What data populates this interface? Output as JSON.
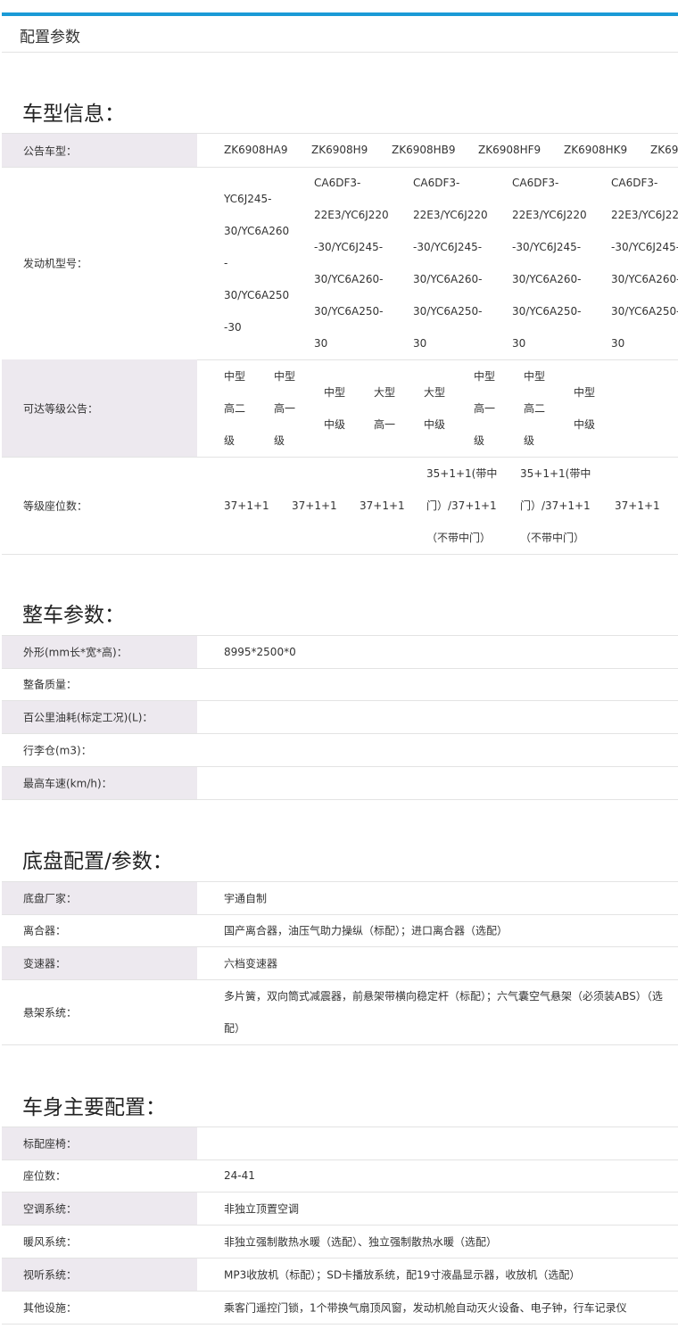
{
  "page_title": "配置参数",
  "sections": {
    "vehicle_info": {
      "title": "车型信息：",
      "models": {
        "label": "公告车型：",
        "values": [
          "ZK6908HA9",
          "ZK6908H9",
          "ZK6908HB9",
          "ZK6908HF9",
          "ZK6908HK9",
          "ZK69"
        ]
      },
      "engines": {
        "label": "发动机型号：",
        "col1": [
          "YC6J245-",
          "30/YC6A260",
          "-",
          "30/YC6A250",
          "-30"
        ],
        "col_other": [
          "CA6DF3-",
          "22E3/YC6J220",
          "-30/YC6J245-",
          "30/YC6A260-",
          "30/YC6A250-",
          "30"
        ],
        "col_last": [
          "CA6DF3-",
          "22E3/YC6J22",
          "-30/YC6J245-",
          "30/YC6A260-",
          "30/YC6A250-",
          "30"
        ]
      },
      "grades": {
        "label": "可达等级公告：",
        "values": [
          [
            "中型",
            "高二",
            "级"
          ],
          [
            "中型",
            "高一",
            "级"
          ],
          [
            "中型",
            "中级"
          ],
          [
            "大型",
            "高一"
          ],
          [
            "大型",
            "中级"
          ],
          [
            "中型",
            "高一",
            "级"
          ],
          [
            "中型",
            "高二",
            "级"
          ],
          [
            "中型",
            "中级"
          ]
        ]
      },
      "seats": {
        "label": "等级座位数：",
        "simple": "37+1+1",
        "complex": [
          "35+1+1(带中",
          "门）/37+1+1",
          "（不带中门）"
        ]
      }
    },
    "whole_vehicle": {
      "title": "整车参数：",
      "rows": [
        {
          "label": "外形(mm长*宽*高)：",
          "value": "8995*2500*0"
        },
        {
          "label": "整备质量：",
          "value": ""
        },
        {
          "label": "百公里油耗(标定工况)(L)：",
          "value": ""
        },
        {
          "label": "行李仓(m3)：",
          "value": ""
        },
        {
          "label": "最高车速(km/h)：",
          "value": ""
        }
      ]
    },
    "chassis": {
      "title": "底盘配置/参数：",
      "rows": [
        {
          "label": "底盘厂家：",
          "value": "宇通自制"
        },
        {
          "label": "离合器：",
          "value": "国产离合器，油压气助力操纵（标配）；进口离合器（选配）"
        },
        {
          "label": "变速器：",
          "value": "六档变速器"
        },
        {
          "label": "悬架系统：",
          "value_line1": "多片簧，双向筒式减震器，前悬架带横向稳定杆（标配）；六气囊空气悬架（必须装ABS）（选",
          "value_line2": "配）"
        }
      ]
    },
    "body": {
      "title": "车身主要配置：",
      "rows": [
        {
          "label": "标配座椅：",
          "value": ""
        },
        {
          "label": "座位数：",
          "value": "24-41"
        },
        {
          "label": "空调系统：",
          "value": "非独立顶置空调"
        },
        {
          "label": "暖风系统：",
          "value": "非独立强制散热水暖（选配）、独立强制散热水暖（选配）"
        },
        {
          "label": "视听系统：",
          "value": "MP3收放机（标配）；SD卡播放系统，配19寸液晶显示器，收放机（选配）"
        },
        {
          "label": "其他设施：",
          "value": "乘客门遥控门锁，1个带换气扇顶风窗，发动机舱自动灭火设备、电子钟，行车记录仪"
        }
      ]
    }
  }
}
